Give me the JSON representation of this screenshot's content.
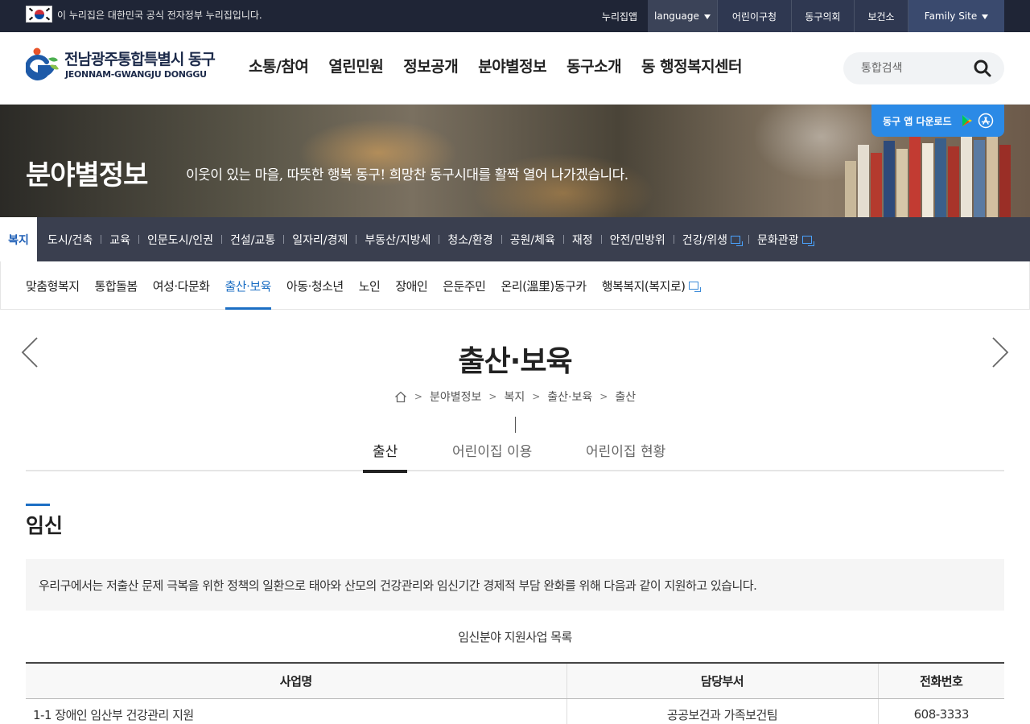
{
  "gov_bar": {
    "notice": "이 누리집은 대한민국 공식 전자정부 누리집입니다.",
    "links": {
      "app": "누리집앱",
      "language": "language",
      "children_office": "어린이구청",
      "council": "동구의회",
      "health_center": "보건소",
      "family_site": "Family Site"
    }
  },
  "header": {
    "logo_kr": "전남광주통합특별시 동구",
    "logo_en": "JEONNAM-GWANGJU DONGGU",
    "gnb": [
      "소통/참여",
      "열린민원",
      "정보공개",
      "분야별정보",
      "동구소개",
      "동 행정복지센터"
    ],
    "search_placeholder": "통합검색"
  },
  "banner": {
    "title": "분야별정보",
    "subtitle": "이웃이 있는 마을, 따뜻한 행복 동구! 희망찬 동구시대를 활짝 열어 나가겠습니다.",
    "app_download": "동구 앱 다운로드"
  },
  "category_tabs": {
    "active": "복지",
    "items": [
      "도시/건축",
      "교육",
      "인문도시/인권",
      "건설/교통",
      "일자리/경제",
      "부동산/지방세",
      "청소/환경",
      "공원/체육",
      "재정",
      "안전/민방위",
      "건강/위생",
      "문화관광"
    ]
  },
  "sub_tabs": {
    "items": [
      "맞춤형복지",
      "통합돌봄",
      "여성·다문화",
      "출산·보육",
      "아동·청소년",
      "노인",
      "장애인",
      "은둔주민",
      "온리(溫里)동구카",
      "행복복지(복지로)"
    ],
    "active_index": 3
  },
  "page": {
    "title": "출산·보육",
    "breadcrumb": [
      "분야별정보",
      "복지",
      "출산·보육",
      "출산"
    ]
  },
  "content_tabs": {
    "items": [
      "출산",
      "어린이집 이용",
      "어린이집 현황"
    ],
    "active_index": 0
  },
  "section": {
    "title": "임신",
    "intro": "우리구에서는 저출산 문제 극복을 위한 정책의 일환으로 태아와 산모의 건강관리와 임신기간 경제적 부담 완화를 위해 다음과 같이 지원하고 있습니다.",
    "table_caption": "임신분야 지원사업 목록",
    "table": {
      "headers": [
        "사업명",
        "담당부서",
        "전화번호"
      ],
      "rows": [
        [
          "1-1 장애인 임산부 건강관리 지원",
          "공공보건과 가족보건팀",
          "608-3333"
        ]
      ]
    }
  },
  "colors": {
    "gov_bar": "#1f2536",
    "category_bar": "#3a3f4f",
    "accent_blue": "#1c6fc4",
    "app_button": "#2b8ae6"
  }
}
